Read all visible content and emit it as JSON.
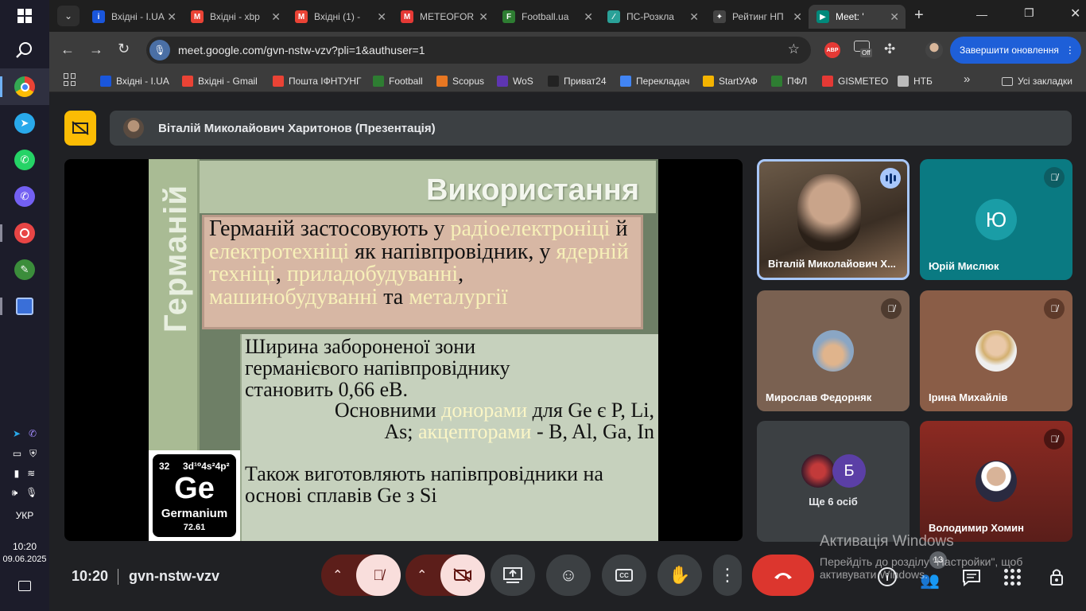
{
  "tabs": [
    {
      "label": "Вхідні - I.UA",
      "fav": "i-ua-icon",
      "color": "#1a56db",
      "ch": "i"
    },
    {
      "label": "Вхідні - xbp",
      "fav": "gmail-icon",
      "color": "#ea4335",
      "ch": "M"
    },
    {
      "label": "Вхідні (1) -",
      "fav": "gmail-icon",
      "color": "#ea4335",
      "ch": "M"
    },
    {
      "label": "METEOFOR",
      "fav": "meteofor-icon",
      "color": "#e53935",
      "ch": "M"
    },
    {
      "label": "Football.ua",
      "fav": "football-icon",
      "color": "#2e7d32",
      "ch": "F"
    },
    {
      "label": "ПС-Розкла",
      "fav": "ps-icon",
      "color": "#2aa198",
      "ch": "∕"
    },
    {
      "label": "Рейтинг НП",
      "fav": "rating-icon",
      "color": "#444",
      "ch": "✦"
    },
    {
      "label": "Meet: '",
      "fav": "meet-icon",
      "color": "#00897b",
      "ch": "▶"
    }
  ],
  "toolbar": {
    "url": "meet.google.com/gvn-nstw-vzv?pli=1&authuser=1",
    "update_label": "Завершити оновлення",
    "abp_label": "ABP",
    "off_label": "Off"
  },
  "bookmarks": [
    {
      "label": "Вхідні - I.UA",
      "color": "#1a56db"
    },
    {
      "label": "Вхідні - Gmail",
      "color": "#ea4335"
    },
    {
      "label": "Пошта ІФНТУНГ",
      "color": "#ea4335"
    },
    {
      "label": "Football",
      "color": "#2e7d32"
    },
    {
      "label": "Scopus",
      "color": "#e87722"
    },
    {
      "label": "WoS",
      "color": "#5e35b1"
    },
    {
      "label": "Приват24",
      "color": "#222"
    },
    {
      "label": "Перекладач",
      "color": "#4285f4"
    },
    {
      "label": "StartУАФ",
      "color": "#f4b400"
    },
    {
      "label": "ПФЛ",
      "color": "#2e7d32"
    },
    {
      "label": "GISMETEO",
      "color": "#e53935"
    },
    {
      "label": "НТБ",
      "color": "#bbb"
    }
  ],
  "all_bookmarks_label": "Усі закладки",
  "taskbar": {
    "lang": "УКР",
    "time": "10:20",
    "date": "09.06.2025"
  },
  "presenter": {
    "name": "Віталій Миколайович Харитонов (Презентація)"
  },
  "slide": {
    "side_title": "Германій",
    "heading": "Використання",
    "para1": [
      {
        "t": "Германій застосовують у ",
        "hl": false
      },
      {
        "t": "радіоелектроніці",
        "hl": true
      },
      {
        "t": " й ",
        "hl": false
      },
      {
        "t": "електротехніці",
        "hl": true
      },
      {
        "t": " як напівпровідник, у ",
        "hl": false
      },
      {
        "t": "ядерній техніці",
        "hl": true
      },
      {
        "t": ", ",
        "hl": false
      },
      {
        "t": "приладобудуванні",
        "hl": true
      },
      {
        "t": ", ",
        "hl": false
      },
      {
        "t": "машинобудуванні",
        "hl": true
      },
      {
        "t": " та ",
        "hl": false
      },
      {
        "t": "металургії",
        "hl": true
      }
    ],
    "para2": "Ширина забороненої зони германієвого напівпровіднику становить 0,66 еВ.",
    "para3": [
      {
        "t": "Основними ",
        "hl": false
      },
      {
        "t": "донорами",
        "hl": true
      },
      {
        "t": " для Ge є P, Li, As; ",
        "hl": false
      },
      {
        "t": "акцепторами",
        "hl": true
      },
      {
        "t": " - B, Al, Ga, In",
        "hl": false
      }
    ],
    "para4": "Також виготовляють напівпровідники на основі сплавів Ge з Si",
    "element": {
      "number": "32",
      "config": "3d¹⁰4s²4p²",
      "symbol": "Ge",
      "name": "Germanium",
      "mass": "72.61"
    }
  },
  "participants": [
    {
      "name": "Віталій Миколайович Х...",
      "speaking": true
    },
    {
      "name": "Юрій Мислюк",
      "initial": "Ю",
      "muted": true
    },
    {
      "name": "Мирослав Федорняк",
      "muted": true
    },
    {
      "name": "Ірина Михайлів",
      "muted": true
    },
    {
      "name": "Ще 6 осіб",
      "initial": "Б"
    },
    {
      "name": "Володимир Хомин",
      "muted": true
    }
  ],
  "bottom": {
    "time": "10:20",
    "code": "gvn-nstw-vzv",
    "people_count": "13"
  },
  "activation": {
    "title": "Активація Windows",
    "line1": "Перейдіть до розділу \"Настройки\", щоб",
    "line2": "активувати Windows."
  }
}
